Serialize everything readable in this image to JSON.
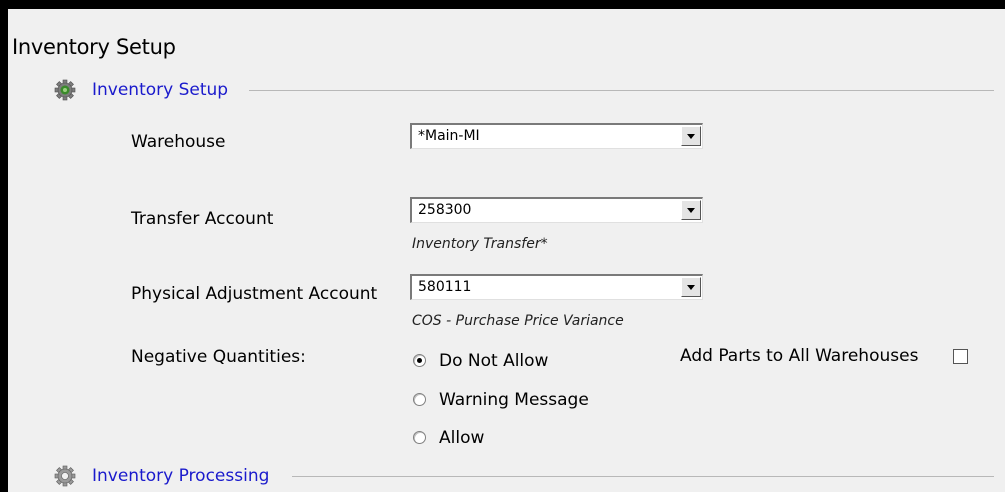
{
  "page": {
    "title": "Inventory Setup"
  },
  "sections": {
    "setup": {
      "title": "Inventory Setup",
      "icon": "gear-icon"
    },
    "processing": {
      "title": "Inventory Processing",
      "icon": "gear-icon"
    }
  },
  "form": {
    "warehouse": {
      "label": "Warehouse",
      "value": "*Main-MI"
    },
    "transfer_account": {
      "label": "Transfer Account",
      "value": "258300",
      "description": "Inventory Transfer*"
    },
    "physical_adjustment_account": {
      "label": "Physical Adjustment Account",
      "value": "580111",
      "description": "COS - Purchase Price Variance"
    },
    "negative_quantities": {
      "label": "Negative Quantities:",
      "options": [
        "Do Not Allow",
        "Warning Message",
        "Allow"
      ],
      "selected": "Do Not Allow"
    },
    "add_parts_all_warehouses": {
      "label": "Add Parts to All Warehouses",
      "checked": false
    }
  },
  "colors": {
    "section_title": "#1a1acc",
    "background": "#f0f0f0",
    "frame_border": "#000000"
  }
}
